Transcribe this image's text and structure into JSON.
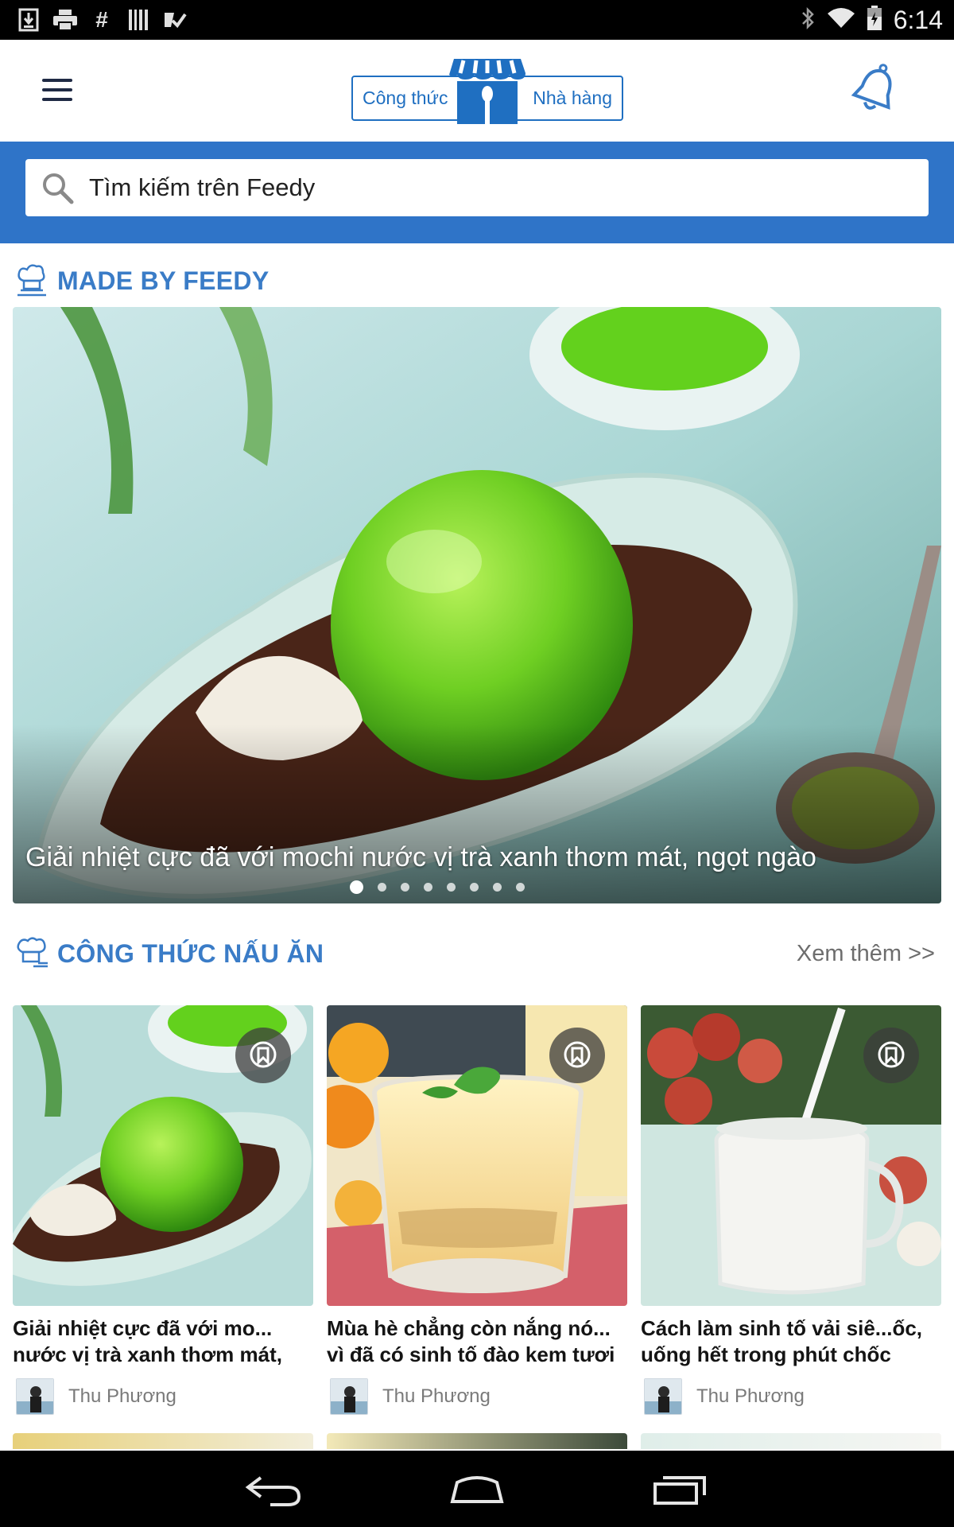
{
  "status_bar": {
    "time": "6:14",
    "icons": [
      "download-icon",
      "print-icon",
      "hashtag-icon",
      "barcode-icon",
      "checklist-icon",
      "bluetooth-icon",
      "wifi-icon",
      "battery-icon"
    ]
  },
  "app_bar": {
    "tab_recipes": "Công thức",
    "tab_restaurants": "Nhà hàng",
    "menu_icon": "menu-icon",
    "notification_icon": "bell-icon"
  },
  "search": {
    "placeholder": "Tìm kiếm trên Feedy"
  },
  "made_by_feedy": {
    "title": "MADE BY FEEDY",
    "hero_caption": "Giải nhiệt cực đã với mochi nước vị trà xanh thơm mát, ngọt ngào",
    "carousel_page": 1,
    "carousel_pages": 8
  },
  "recipes": {
    "title": "CÔNG THỨC NẤU ĂN",
    "more": "Xem thêm >>",
    "cards": [
      {
        "title_line1": "Giải nhiệt cực đã với mo...",
        "title_line2": "nước vị trà xanh thơm mát,",
        "author": "Thu Phương"
      },
      {
        "title_line1": "Mùa hè chẳng còn nắng nó...",
        "title_line2": "vì đã có sinh tố đào kem tươi",
        "author": "Thu Phương"
      },
      {
        "title_line1": "Cách làm sinh tố vải siê...ốc,",
        "title_line2": "uống hết trong phút chốc",
        "author": "Thu Phương"
      }
    ]
  },
  "colors": {
    "brand_blue": "#2f74c8",
    "title_blue": "#3a7cc7"
  }
}
